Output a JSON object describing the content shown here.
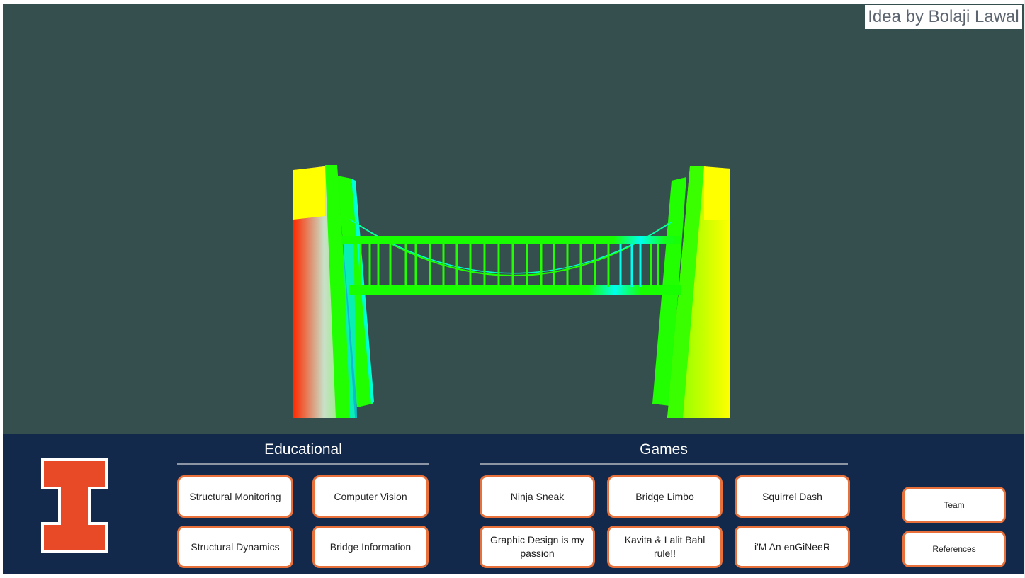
{
  "viewport": {
    "credit": "Idea by Bolaji Lawal",
    "background": "#354e4e"
  },
  "bottom_bar": {
    "background": "#13294b",
    "logo_icon": "university-block-i-logo",
    "educational": {
      "title": "Educational",
      "buttons": [
        "Structural Monitoring",
        "Computer Vision",
        "Structural Dynamics",
        "Bridge Information"
      ]
    },
    "games": {
      "title": "Games",
      "buttons": [
        "Ninja Sneak",
        "Bridge Limbo",
        "Squirrel Dash",
        "Graphic Design is my passion",
        "Kavita & Lalit Bahl rule!!",
        "i'M An enGiNeeR"
      ]
    },
    "side_buttons": [
      "Team",
      "References"
    ]
  },
  "colors": {
    "accent_orange": "#e8703a",
    "navy": "#13294b",
    "bridge_green": "#1aff00",
    "tower_yellow": "#ffff00",
    "stress_red": "#ff1a00",
    "stress_cyan": "#00ffff"
  }
}
